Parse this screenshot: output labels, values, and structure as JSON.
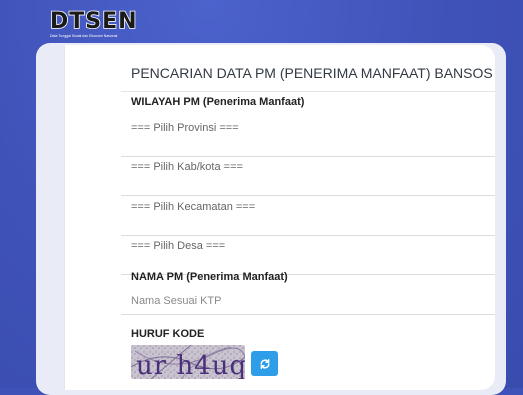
{
  "brand": {
    "logo_text": "DTSEN",
    "tagline": "Data Tunggal Sosial dan Ekonomi Nasional"
  },
  "form": {
    "title": "PENCARIAN DATA PM (PENERIMA MANFAAT) BANSOS",
    "wilayah_label": "WILAYAH PM (Penerima Manfaat)",
    "provinsi_select": "=== Pilih Provinsi ===",
    "kabkota_select": "=== Pilih Kab/kota ===",
    "kecamatan_select": "=== Pilih Kecamatan ===",
    "desa_select": "=== Pilih Desa ===",
    "nama_label": "NAMA PM (Penerima Manfaat)",
    "nama_placeholder": "Nama Sesuai KTP",
    "nama_value": "",
    "kode_label": "HURUF KODE",
    "captcha_text": "ur h4uq"
  },
  "icons": {
    "refresh": "refresh-icon"
  },
  "colors": {
    "background": "#3f52b8",
    "button": "#2f9ee8",
    "captcha_text": "#4b2f7a"
  }
}
